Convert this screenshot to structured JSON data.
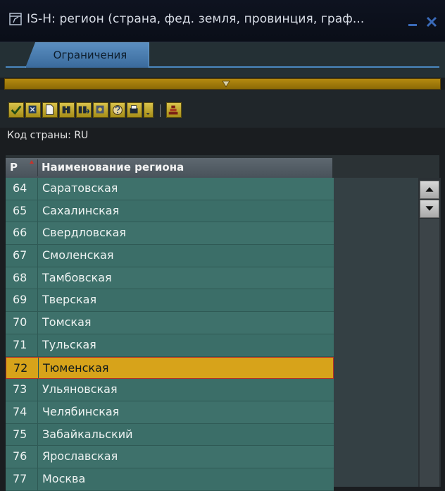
{
  "window": {
    "title": "IS-H: регион (страна, фед. земля, провинция, граф..."
  },
  "tabs": [
    {
      "label": "Ограничения"
    }
  ],
  "filter": {
    "country_text": "Код страны: RU"
  },
  "table": {
    "columns": [
      "Р",
      "Наименование региона"
    ],
    "rows": [
      {
        "code": "64",
        "name": "Саратовская",
        "selected": false
      },
      {
        "code": "65",
        "name": "Сахалинская",
        "selected": false
      },
      {
        "code": "66",
        "name": "Свердловская",
        "selected": false
      },
      {
        "code": "67",
        "name": "Смоленская",
        "selected": false
      },
      {
        "code": "68",
        "name": "Тамбовская",
        "selected": false
      },
      {
        "code": "69",
        "name": "Тверская",
        "selected": false
      },
      {
        "code": "70",
        "name": "Томская",
        "selected": false
      },
      {
        "code": "71",
        "name": "Тульская",
        "selected": false
      },
      {
        "code": "72",
        "name": "Тюменская",
        "selected": true
      },
      {
        "code": "73",
        "name": "Ульяновская",
        "selected": false
      },
      {
        "code": "74",
        "name": "Челябинская",
        "selected": false
      },
      {
        "code": "75",
        "name": "Забайкальский",
        "selected": false
      },
      {
        "code": "76",
        "name": "Ярославская",
        "selected": false
      },
      {
        "code": "77",
        "name": "Москва",
        "selected": false
      }
    ]
  },
  "icons": {
    "title": "window-edit-icon",
    "toolbar": [
      "checkmark-icon",
      "close-icon",
      "new-document-icon",
      "find-icon",
      "find-next-icon",
      "export-icon",
      "help-icon",
      "print-icon",
      "dropdown-icon",
      "technical-icon"
    ]
  },
  "colors": {
    "row": "#3b6e68",
    "selected": "#d7a31a",
    "accent": "#b48a10"
  }
}
